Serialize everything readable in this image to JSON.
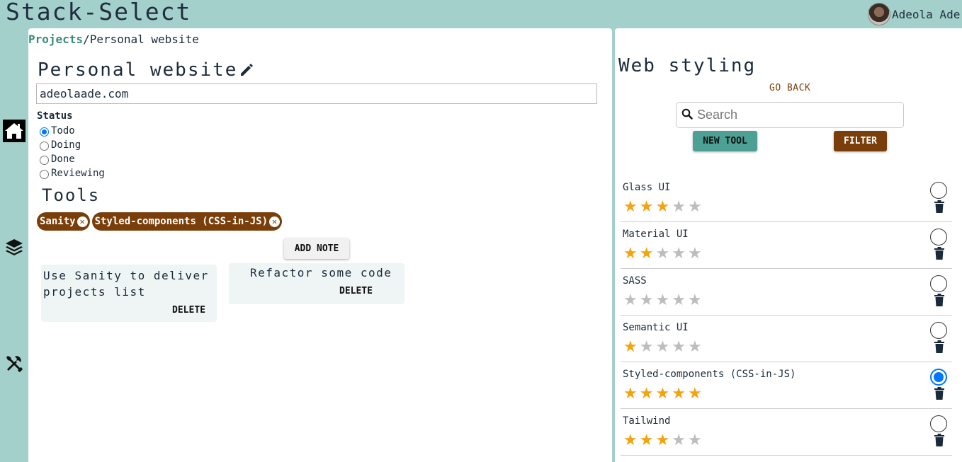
{
  "app": {
    "title": "Stack-Select"
  },
  "user": {
    "name": "Adeola Ade"
  },
  "sidebar": {
    "icons": [
      "home-icon",
      "layers-icon",
      "tools-icon"
    ]
  },
  "breadcrumb": {
    "root": "Projects",
    "separator": "/",
    "current": "Personal website"
  },
  "project": {
    "title": "Personal website",
    "url": "adeolaade.com",
    "status_label": "Status",
    "status_options": [
      {
        "label": "Todo",
        "checked": true
      },
      {
        "label": "Doing",
        "checked": false
      },
      {
        "label": "Done",
        "checked": false
      },
      {
        "label": "Reviewing",
        "checked": false
      }
    ],
    "tools_heading": "Tools",
    "tool_chips": [
      "Sanity",
      "Styled-components (CSS-in-JS)"
    ],
    "chip_close_glyph": "✕",
    "add_note_label": "ADD NOTE",
    "notes": [
      {
        "text": "Use Sanity to deliver projects list",
        "delete_label": "DELETE"
      },
      {
        "text": "Refactor some code",
        "delete_label": "DELETE"
      }
    ]
  },
  "category": {
    "title": "Web styling",
    "go_back_label": "GO BACK",
    "search_placeholder": "Search",
    "new_tool_label": "NEW TOOL",
    "filter_label": "FILTER",
    "tools": [
      {
        "name": "Glass UI",
        "rating": 3,
        "selected": false
      },
      {
        "name": "Material UI",
        "rating": 2,
        "selected": false
      },
      {
        "name": "SASS",
        "rating": 0,
        "selected": false
      },
      {
        "name": "Semantic UI",
        "rating": 1,
        "selected": false
      },
      {
        "name": "Styled-components (CSS-in-JS)",
        "rating": 5,
        "selected": true
      },
      {
        "name": "Tailwind",
        "rating": 3,
        "selected": false
      }
    ],
    "max_rating": 5
  },
  "colors": {
    "background": "#a3d0ca",
    "accent_teal": "#4ca094",
    "accent_brown": "#7a3e0a",
    "star_on": "#f4a30c",
    "star_off": "#bdbdbd",
    "radio_blue": "#0075ff"
  }
}
